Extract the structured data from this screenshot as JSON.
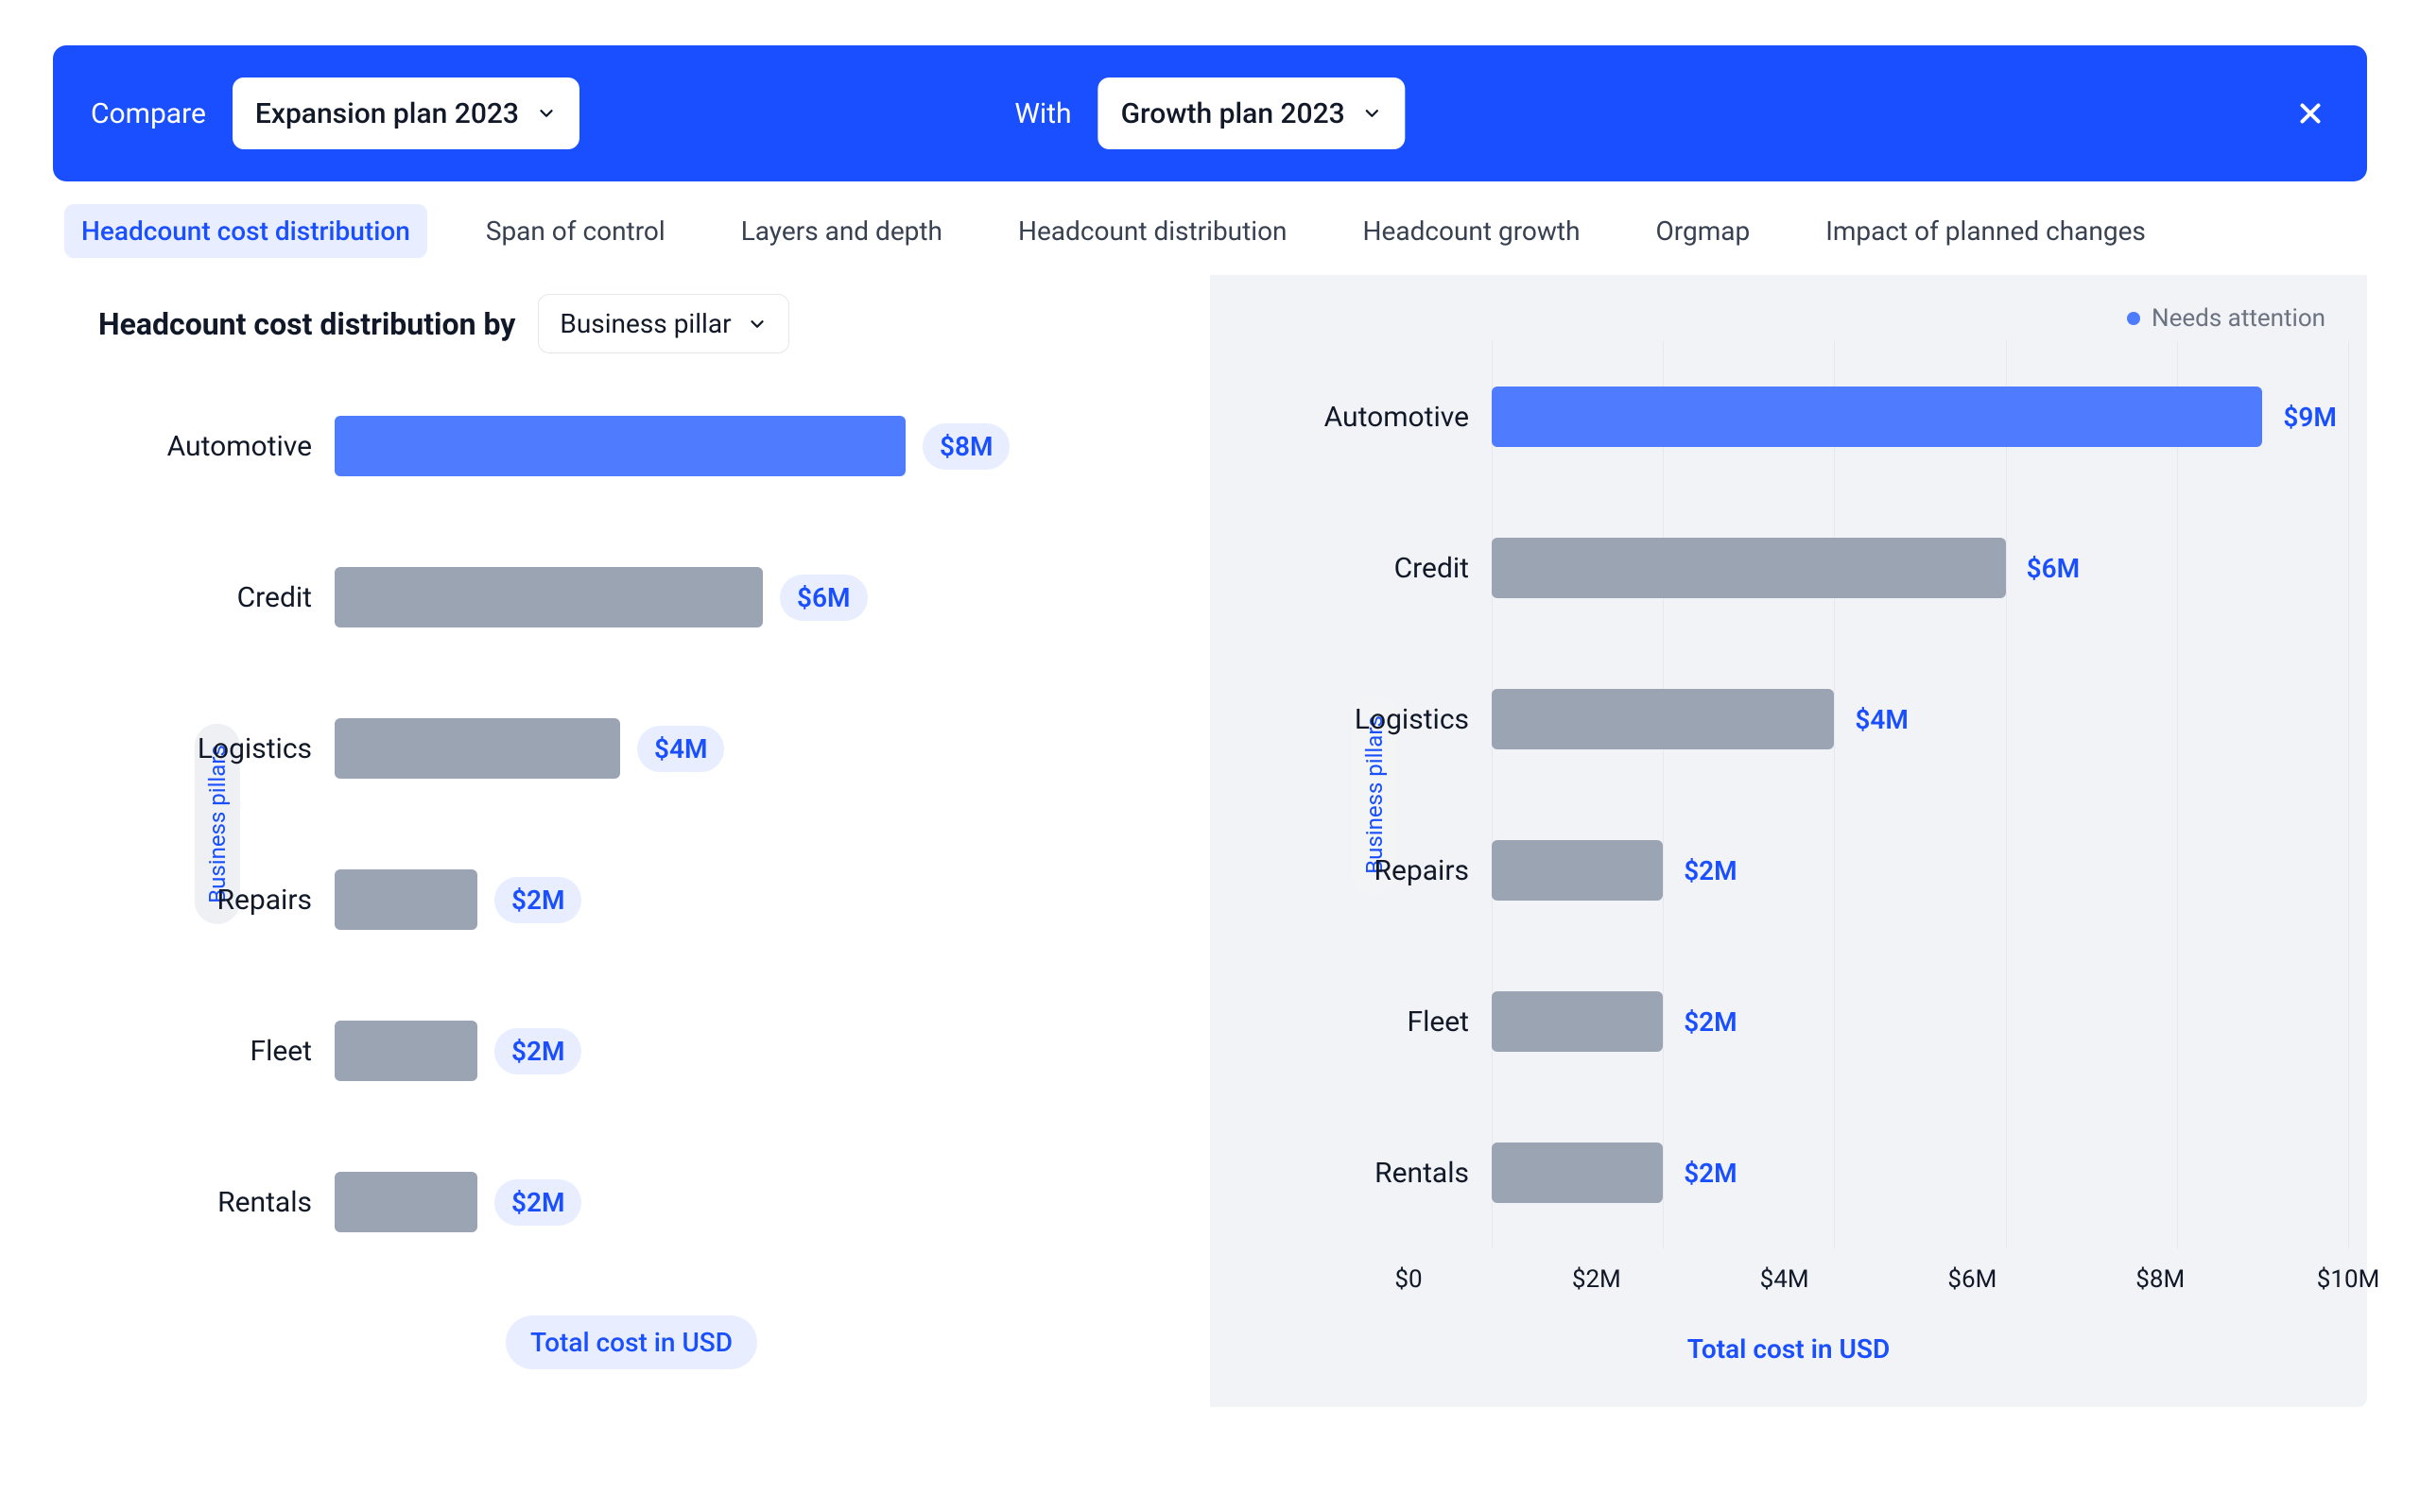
{
  "header": {
    "compare_label": "Compare",
    "plan_a": "Expansion plan 2023",
    "with_label": "With",
    "plan_b": "Growth plan 2023"
  },
  "tabs": [
    "Headcount cost distribution",
    "Span of control",
    "Layers and depth",
    "Headcount distribution",
    "Headcount growth",
    "Orgmap",
    "Impact of planned changes"
  ],
  "active_tab_index": 0,
  "filter": {
    "label_prefix": "Headcount cost distribution by",
    "dropdown_value": "Business pillar"
  },
  "legend": {
    "needs_attention": "Needs attention"
  },
  "y_axis_label": "Business pillars",
  "x_axis_label_left": "Total cost in USD",
  "x_axis_label_right": "Total cost in USD",
  "x_ticks_right": [
    "$0",
    "$2M",
    "$4M",
    "$6M",
    "$8M",
    "$10M"
  ],
  "chart_data": [
    {
      "type": "bar",
      "orientation": "horizontal",
      "scenario": "Expansion plan 2023",
      "xlabel": "Total cost in USD",
      "ylabel": "Business pillars",
      "x_unit": "M USD",
      "xlim": [
        0,
        10
      ],
      "categories": [
        "Automotive",
        "Credit",
        "Logistics",
        "Repairs",
        "Fleet",
        "Rentals"
      ],
      "values": [
        8,
        6,
        4,
        2,
        2,
        2
      ],
      "value_labels": [
        "$8M",
        "$6M",
        "$4M",
        "$2M",
        "$2M",
        "$2M"
      ],
      "needs_attention": [
        true,
        false,
        false,
        false,
        false,
        false
      ]
    },
    {
      "type": "bar",
      "orientation": "horizontal",
      "scenario": "Growth plan 2023",
      "xlabel": "Total cost in USD",
      "ylabel": "Business pillars",
      "x_unit": "M USD",
      "xlim": [
        0,
        10
      ],
      "x_ticks": [
        0,
        2,
        4,
        6,
        8,
        10
      ],
      "categories": [
        "Automotive",
        "Credit",
        "Logistics",
        "Repairs",
        "Fleet",
        "Rentals"
      ],
      "values": [
        9,
        6,
        4,
        2,
        2,
        2
      ],
      "value_labels": [
        "$9M",
        "$6M",
        "$4M",
        "$2M",
        "$2M",
        "$2M"
      ],
      "needs_attention": [
        true,
        false,
        false,
        false,
        false,
        false
      ],
      "legend": [
        {
          "label": "Needs attention",
          "color": "#4f7cff"
        }
      ]
    }
  ],
  "colors": {
    "highlight": "#4f7cff",
    "default": "#9aa4b3",
    "accent": "#1a4fff"
  }
}
